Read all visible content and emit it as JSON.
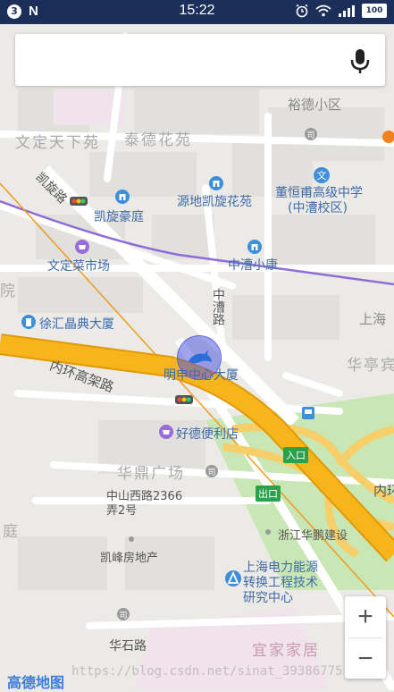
{
  "status_bar": {
    "notification_count": "3",
    "time": "15:22",
    "battery": "100"
  },
  "search": {
    "value": "",
    "placeholder": ""
  },
  "map": {
    "labels": {
      "yude_xiaoqu": "裕德小区",
      "taide_huayuan": "泰德花苑",
      "wending_tianxiayuan": "文定天下苑",
      "kaixuan_lu": "凯旋路",
      "yuandi_kaixuan_huayuan": "源地凯旋花苑",
      "dongheng_fu_school_1": "董恒甫高级中学",
      "dongheng_fu_school_2": "(中漕校区)",
      "kaixuan_haoting": "凯旋豪庭",
      "wending_caishichang": "文定菜市场",
      "zhongcao_xiaokang": "中漕小康",
      "zhongcao_lu": "中漕路",
      "xuhui_jingdian_dasha": "徐汇晶典大厦",
      "shanghai_partial": "上海",
      "huating": "华亭宾",
      "neihuan_gaojia": "内环高架路",
      "mingshen_zhongxin": "明申中心大厦",
      "haode_bianlidian": "好德便利店",
      "huading_guangchang": "华鼎广场",
      "zhongshan_xilu_1": "中山西路2366",
      "zhongshan_xilu_2": "弄2号",
      "neihuan_partial": "内环",
      "rukou": "入口",
      "chukou": "出口",
      "zhejiang_huapeng": "浙江华鹏建设",
      "kaifeng_fangdichan": "凯峰房地产",
      "power_center_1": "上海电力能源",
      "power_center_2": "转换工程技术",
      "power_center_3": "研究中心",
      "huashi_lu": "华石路",
      "yijia_jiaju": "宜家家居",
      "ting": "庭",
      "yuan": "院"
    },
    "icons": {
      "search_mic": "microphone-icon",
      "location": "dolphin-location-marker"
    },
    "colors": {
      "expressway": "#f6b51c",
      "expressway_edge": "#e09a00",
      "metro_line": "#8f6cd8",
      "green_space": "#c9e7b5",
      "poi_blue": "#3d8fdc"
    }
  },
  "zoom": {
    "in_label": "+",
    "out_label": "−"
  },
  "footer": {
    "logo": "高德地图",
    "watermark": "https://blog.csdn.net/sinat_39386775"
  }
}
